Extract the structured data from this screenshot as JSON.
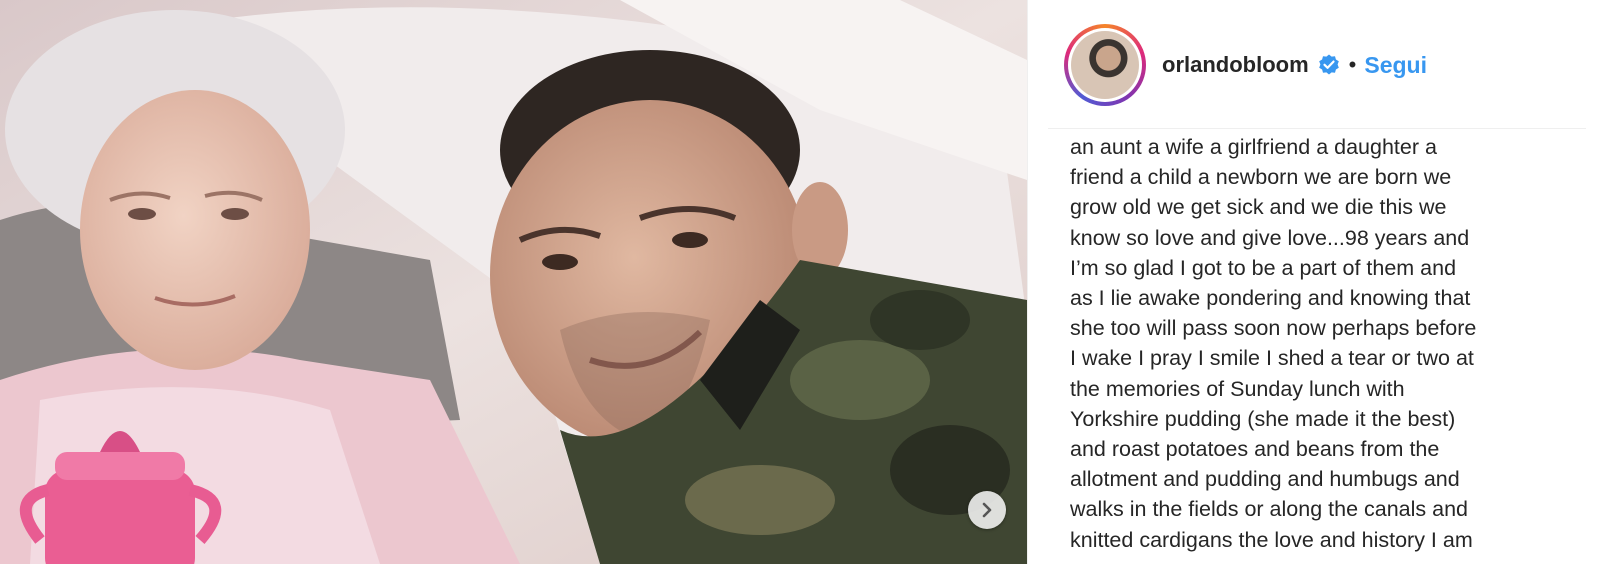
{
  "post": {
    "username": "orlandobloom",
    "separator": "•",
    "follow_label": "Segui",
    "caption_lines": [
      "an aunt a wife a girlfriend a daughter a",
      "friend a child a newborn we are born we",
      "grow old we get sick and we die this we",
      "know so love and give love...98 years and",
      "I’m so glad I got to be a part of them and",
      "as I lie awake pondering and knowing that",
      "she too will pass soon now perhaps before",
      "I wake I pray I smile I shed a tear or two at",
      "the memories of Sunday lunch with",
      "Yorkshire pudding (she made it the best)",
      "and roast potatoes and beans from the",
      "allotment and pudding and humbugs and",
      "walks in the fields or along the canals and",
      "knitted cardigans the love and history I am"
    ]
  },
  "icons": {
    "verified": "verified-badge-icon",
    "next": "chevron-right-icon"
  },
  "colors": {
    "link": "#3897f0",
    "text": "#262626",
    "verified": "#3897f0"
  }
}
